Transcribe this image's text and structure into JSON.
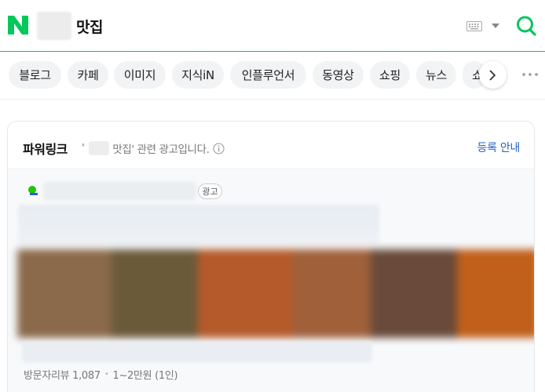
{
  "header": {
    "query_suffix": "맛집",
    "logo_letter": "N",
    "brand_color": "#03c75a"
  },
  "tabs": [
    {
      "label": "블로그"
    },
    {
      "label": "카페"
    },
    {
      "label": "이미지"
    },
    {
      "label": "지식iN"
    },
    {
      "label": "인플루언서"
    },
    {
      "label": "동영상"
    },
    {
      "label": "쇼핑"
    },
    {
      "label": "뉴스"
    },
    {
      "label": "쇼"
    }
  ],
  "powerlink": {
    "title": "파워링크",
    "desc_open": "'",
    "desc_query": "맛집",
    "desc_rest": "' 관련 광고입니다.",
    "register_label": "등록 안내",
    "ad_badge": "광고",
    "meta_reviews": "방문자리뷰 1,087",
    "meta_price": "1~2만원 (1인)",
    "link_color": "#2860c5"
  },
  "icons": {
    "keyboard": "keyboard-icon",
    "dropdown": "chevron-down-icon",
    "search": "search-icon",
    "next": "chevron-right-icon",
    "more": "more-icon",
    "info": "info-icon"
  }
}
